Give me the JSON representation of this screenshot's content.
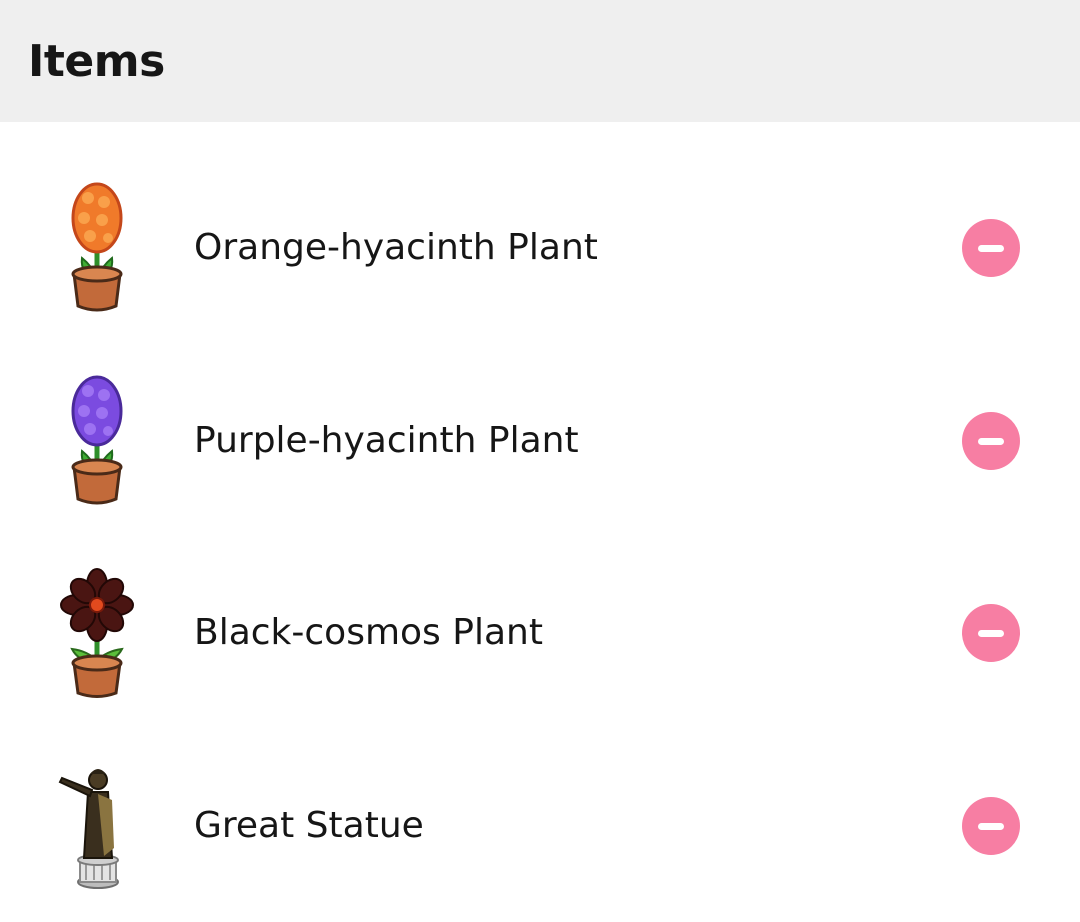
{
  "header": {
    "title": "Items"
  },
  "items": [
    {
      "name": "Orange-hyacinth Plant",
      "icon": "orange-hyacinth-plant-icon",
      "color": "#f07a2a"
    },
    {
      "name": "Purple-hyacinth Plant",
      "icon": "purple-hyacinth-plant-icon",
      "color": "#7b4be0"
    },
    {
      "name": "Black-cosmos Plant",
      "icon": "black-cosmos-plant-icon",
      "color": "#4a1512"
    },
    {
      "name": "Great Statue",
      "icon": "great-statue-icon",
      "color": "#5a4a2e"
    }
  ],
  "colors": {
    "header_bg": "#efefef",
    "remove_button": "#f77ea3",
    "text": "#161616"
  }
}
